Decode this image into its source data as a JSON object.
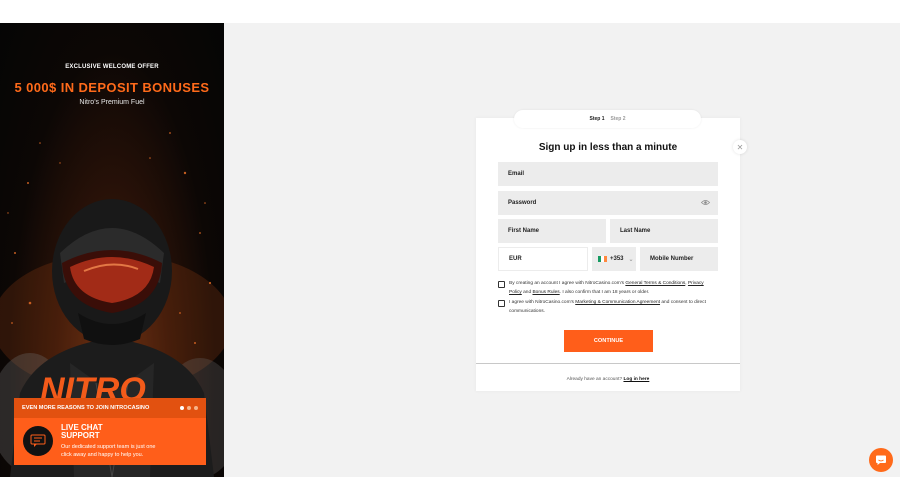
{
  "promo": {
    "eyebrow": "EXCLUSIVE WELCOME OFFER",
    "headline": "5 000$ IN DEPOSIT BONUSES",
    "subline": "Nitro's Premium Fuel",
    "brand_color": "#ff5e1a",
    "reasons": {
      "title": "EVEN MORE REASONS TO JOIN NITROCASINO",
      "active_index": 0,
      "slides": 3,
      "item_title": "LIVE CHAT SUPPORT",
      "item_text": "Our dedicated support team is just one click away and happy to help you."
    }
  },
  "signup": {
    "steps": [
      "Step 1",
      "Step 2"
    ],
    "title": "Sign up in less than a minute",
    "email_placeholder": "Email",
    "password_placeholder": "Password",
    "first_name_placeholder": "First Name",
    "last_name_placeholder": "Last Name",
    "currency": "EUR",
    "phone_prefix": "+353",
    "mobile_placeholder": "Mobile Number",
    "consent_terms": {
      "prefix": "By creating an account I agree with NitroCasino.com's ",
      "link1": "General Terms & Conditions",
      "sep1": ", ",
      "link2": "Privacy Policy",
      "sep2": " and ",
      "link3": "Bonus Rules",
      "suffix": ". I also confirm that I am 18 years or older."
    },
    "consent_marketing": {
      "prefix": "I agree with NitroCasino.com's ",
      "link": "Marketing & Communication Agreement",
      "suffix": " and consent to direct communications."
    },
    "continue_label": "CONTINUE",
    "login_prompt": "Already have an account?",
    "login_link": "Log in here"
  }
}
